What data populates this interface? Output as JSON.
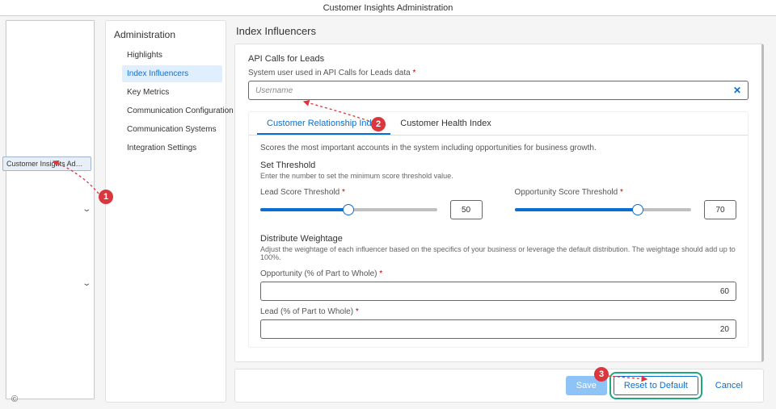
{
  "app_title": "Customer Insights Administration",
  "left_strip": {
    "badge": "Customer Insights Admi..."
  },
  "sidebar": {
    "title": "Administration",
    "items": [
      {
        "label": "Highlights"
      },
      {
        "label": "Index Influencers"
      },
      {
        "label": "Key Metrics"
      },
      {
        "label": "Communication Configuration"
      },
      {
        "label": "Communication Systems"
      },
      {
        "label": "Integration Settings"
      }
    ]
  },
  "page": {
    "title": "Index Influencers",
    "api_section": {
      "heading": "API Calls for Leads",
      "field_label": "System user used in API Calls for Leads data",
      "placeholder": "Username"
    },
    "tabs": [
      {
        "label": "Customer Relationship Index"
      },
      {
        "label": "Customer Health Index"
      }
    ],
    "cri": {
      "desc": "Scores the most important accounts in the system including opportunities for business growth.",
      "set_threshold": "Set Threshold",
      "set_threshold_desc": "Enter the number to set the minimum score threshold value.",
      "lead_threshold_label": "Lead Score Threshold",
      "lead_threshold_value": "50",
      "opp_threshold_label": "Opportunity Score Threshold",
      "opp_threshold_value": "70",
      "dist_heading": "Distribute Weightage",
      "dist_desc": "Adjust the weightage of each influencer based on the specifics of your business or leverage the default distribution. The weightage should add up to 100%.",
      "opp_pct_label": "Opportunity (% of Part to Whole)",
      "opp_pct_value": "60",
      "lead_pct_label": "Lead (% of Part to Whole)",
      "lead_pct_value": "20"
    }
  },
  "footer": {
    "save": "Save",
    "reset": "Reset to Default",
    "cancel": "Cancel"
  },
  "annotations": {
    "c1": "1",
    "c2": "2",
    "c3": "3"
  }
}
